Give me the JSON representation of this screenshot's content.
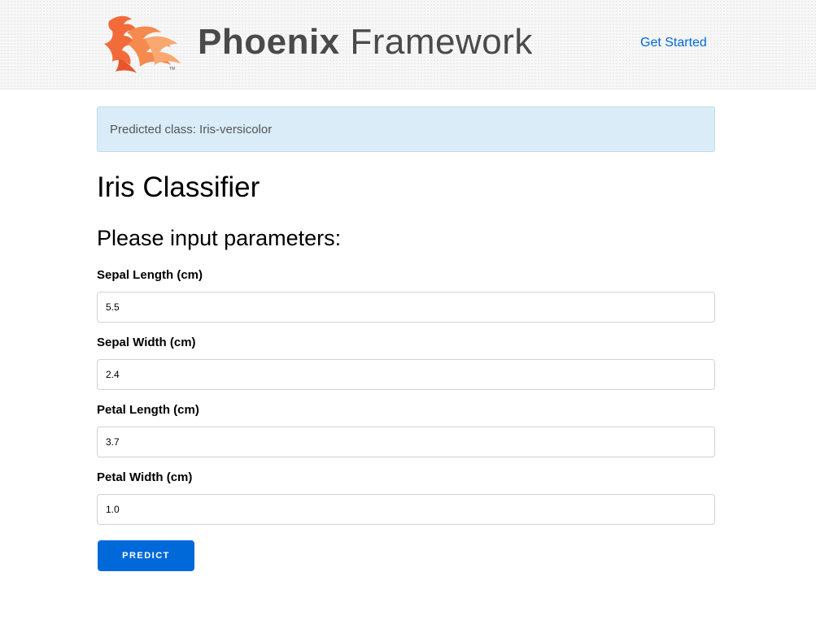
{
  "header": {
    "brand_bold": "Phoenix",
    "brand_light": " Framework",
    "nav_link": "Get Started",
    "logo_icon": "phoenix-bird-icon",
    "logo_color": "#f26b3a"
  },
  "alert": {
    "text": "Predicted class: Iris-versicolor",
    "background": "#d9ecf7"
  },
  "main": {
    "title": "Iris Classifier",
    "subtitle": "Please input parameters:",
    "fields": [
      {
        "label": "Sepal Length (cm)",
        "value": "5.5"
      },
      {
        "label": "Sepal Width (cm)",
        "value": "2.4"
      },
      {
        "label": "Petal Length (cm)",
        "value": "3.7"
      },
      {
        "label": "Petal Width (cm)",
        "value": "1.0"
      }
    ],
    "button_label": "Predict",
    "accent": "#0069d9"
  }
}
